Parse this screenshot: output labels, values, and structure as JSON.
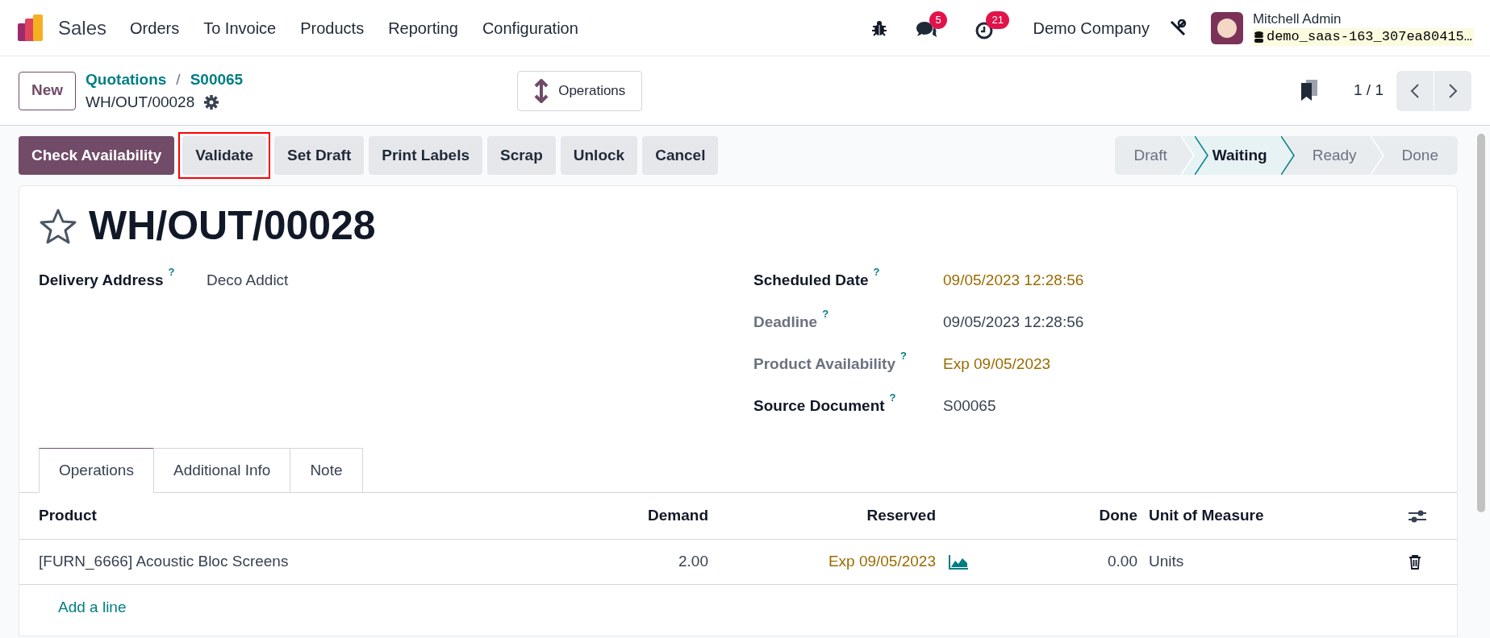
{
  "navbar": {
    "app_name": "Sales",
    "menu": [
      "Orders",
      "To Invoice",
      "Products",
      "Reporting",
      "Configuration"
    ],
    "messages_badge": "5",
    "activities_badge": "21",
    "company": "Demo Company",
    "user_name": "Mitchell Admin",
    "database": "demo_saas-163_307ea80415…"
  },
  "control_panel": {
    "new_button": "New",
    "breadcrumbs": [
      "Quotations",
      "S00065"
    ],
    "breadcrumb_separator": "/",
    "record_name": "WH/OUT/00028",
    "smart_button": "Operations",
    "pager": "1 / 1"
  },
  "actions": [
    {
      "label": "Check Availability",
      "kind": "primary",
      "highlighted": false
    },
    {
      "label": "Validate",
      "kind": "secondary",
      "highlighted": true
    },
    {
      "label": "Set Draft",
      "kind": "secondary",
      "highlighted": false
    },
    {
      "label": "Print Labels",
      "kind": "secondary",
      "highlighted": false
    },
    {
      "label": "Scrap",
      "kind": "secondary",
      "highlighted": false
    },
    {
      "label": "Unlock",
      "kind": "secondary",
      "highlighted": false
    },
    {
      "label": "Cancel",
      "kind": "secondary",
      "highlighted": false
    }
  ],
  "statusbar": [
    {
      "label": "Draft",
      "selected": false
    },
    {
      "label": "Waiting",
      "selected": true
    },
    {
      "label": "Ready",
      "selected": false
    },
    {
      "label": "Done",
      "selected": false
    }
  ],
  "form": {
    "title": "WH/OUT/00028",
    "starred": false,
    "left_fields": [
      {
        "label": "Delivery Address",
        "help": "?",
        "value": "Deco Addict",
        "muted": false,
        "kind": "plain"
      }
    ],
    "right_fields": [
      {
        "label": "Scheduled Date",
        "help": "?",
        "value": "09/05/2023 12:28:56",
        "muted": false,
        "kind": "warning"
      },
      {
        "label": "Deadline",
        "help": "?",
        "value": "09/05/2023 12:28:56",
        "muted": true,
        "kind": "plain"
      },
      {
        "label": "Product Availability",
        "help": "?",
        "value": "Exp 09/05/2023",
        "muted": true,
        "kind": "warning"
      },
      {
        "label": "Source Document",
        "help": "?",
        "value": "S00065",
        "muted": false,
        "kind": "plain"
      }
    ]
  },
  "tabs": [
    {
      "label": "Operations",
      "selected": true
    },
    {
      "label": "Additional Info",
      "selected": false
    },
    {
      "label": "Note",
      "selected": false
    }
  ],
  "table": {
    "columns": [
      "Product",
      "Demand",
      "Reserved",
      "Done",
      "Unit of Measure"
    ],
    "rows": [
      {
        "product": "[FURN_6666] Acoustic Bloc Screens",
        "demand": "2.00",
        "reserved": "Exp 09/05/2023",
        "done": "0.00",
        "unit": "Units"
      }
    ],
    "add_line": "Add a line"
  }
}
